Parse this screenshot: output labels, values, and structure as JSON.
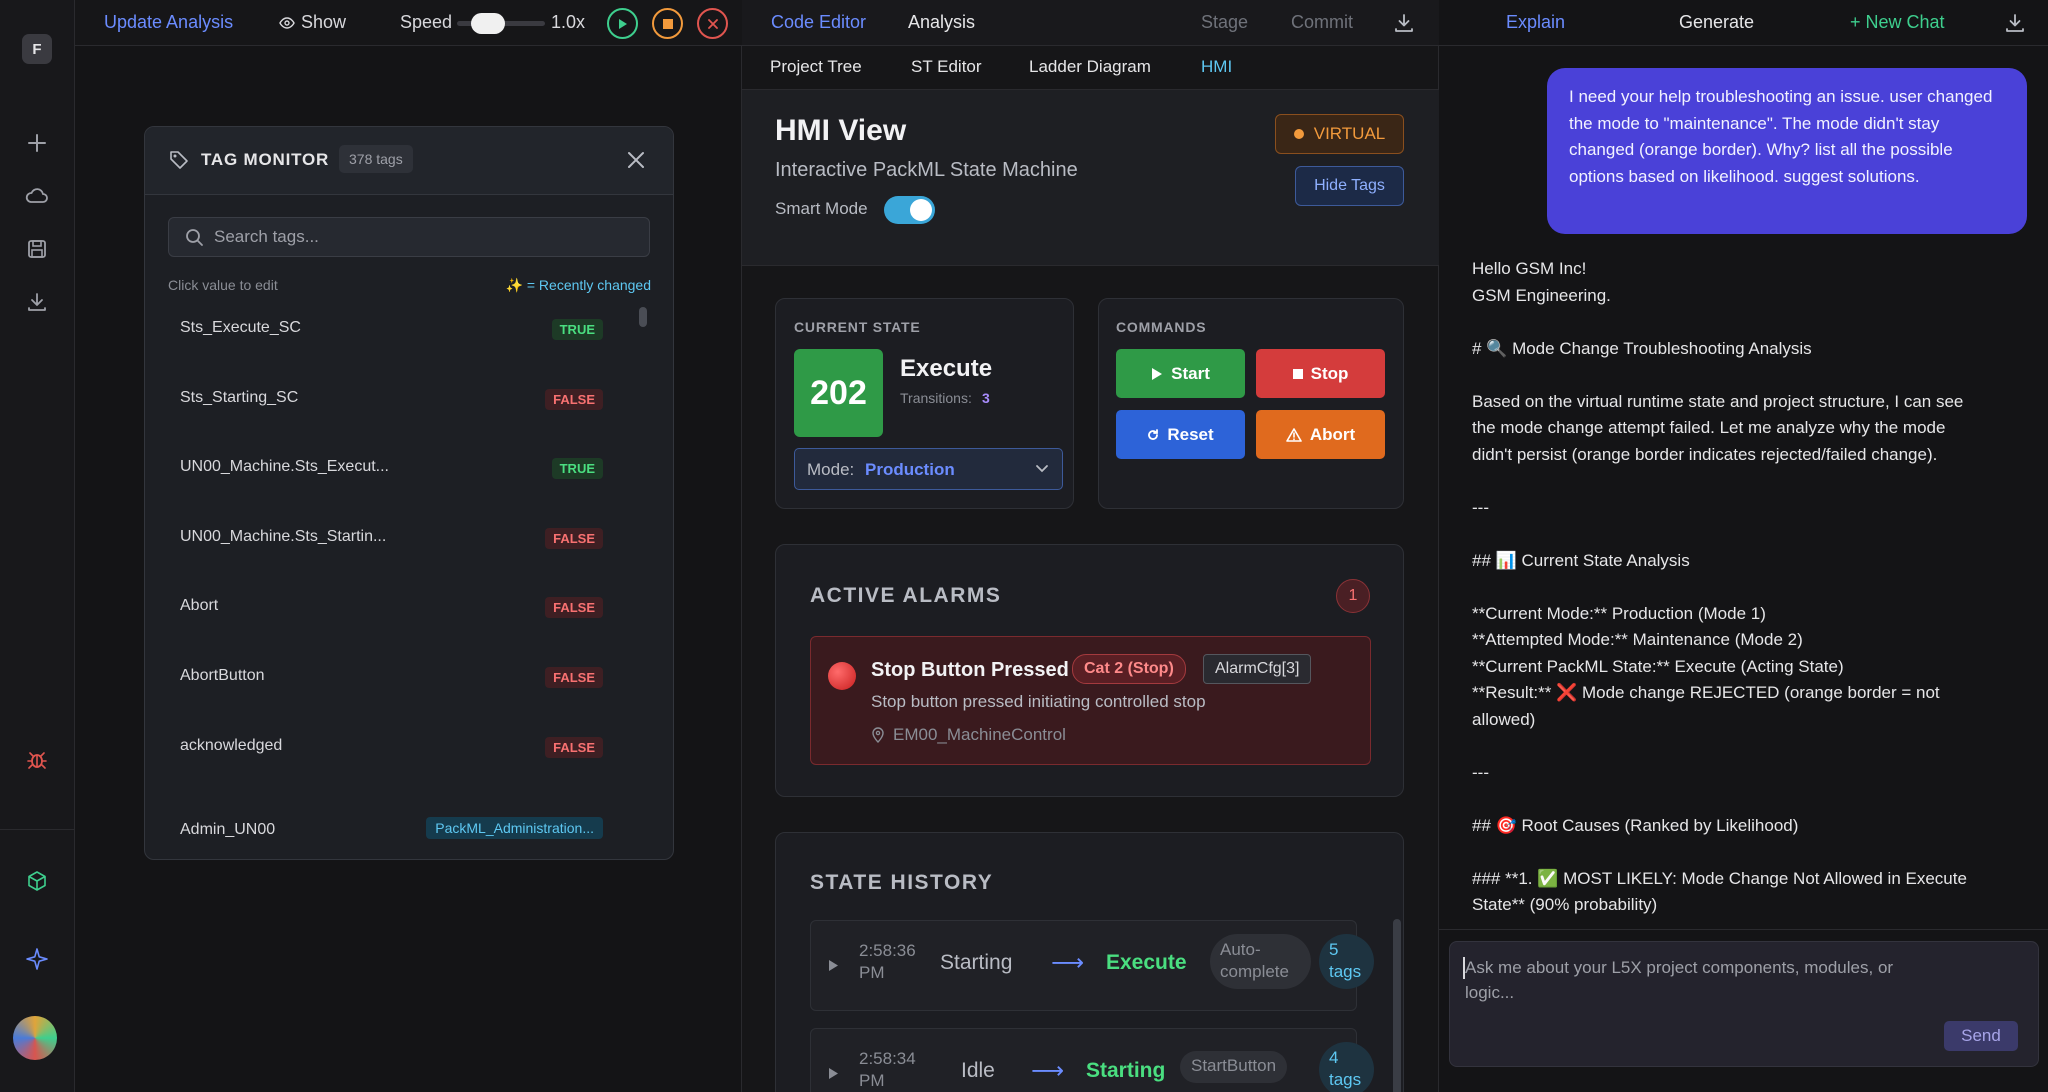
{
  "rail": {
    "logo": "F",
    "icons": [
      "plus-icon",
      "cloud-icon",
      "save-icon",
      "download-icon",
      "bug-icon",
      "cube-icon",
      "sparkle-icon",
      "avatar"
    ]
  },
  "toolbar": {
    "update_analysis": "Update Analysis",
    "show": "Show",
    "speed_label": "Speed",
    "speed_value": "1.0x",
    "speed_fraction": 0.35
  },
  "tag_monitor": {
    "title": "TAG MONITOR",
    "count": "378 tags",
    "search_placeholder": "Search tags...",
    "hint": "Click value to edit",
    "recent_hint": "✨ = Recently changed",
    "rows": [
      {
        "name": "Sts_Execute_SC",
        "value": "TRUE",
        "kind": "true"
      },
      {
        "name": "Sts_Starting_SC",
        "value": "FALSE",
        "kind": "false"
      },
      {
        "name": "UN00_Machine.Sts_Execut...",
        "value": "TRUE",
        "kind": "true"
      },
      {
        "name": "UN00_Machine.Sts_Startin...",
        "value": "FALSE",
        "kind": "false"
      },
      {
        "name": "Abort",
        "value": "FALSE",
        "kind": "false"
      },
      {
        "name": "AbortButton",
        "value": "FALSE",
        "kind": "false"
      },
      {
        "name": "acknowledged",
        "value": "FALSE",
        "kind": "false"
      },
      {
        "name": "Admin_UN00",
        "value": "PackML_Administration...",
        "kind": "type"
      }
    ]
  },
  "middle": {
    "tabs": [
      "Code Editor",
      "Analysis"
    ],
    "stage": "Stage",
    "commit": "Commit",
    "subtabs": [
      "Project Tree",
      "ST Editor",
      "Ladder Diagram",
      "HMI"
    ],
    "hmi_title": "HMI View",
    "hmi_subtitle": "Interactive PackML State Machine",
    "virtual_badge": "VIRTUAL",
    "hide_tags": "Hide Tags",
    "smart_mode": "Smart Mode",
    "current_state": {
      "label": "CURRENT STATE",
      "code": "202",
      "name": "Execute",
      "transitions_label": "Transitions:",
      "transitions": "3",
      "mode_label": "Mode:",
      "mode_value": "Production"
    },
    "commands": {
      "label": "COMMANDS",
      "start": "Start",
      "stop": "Stop",
      "reset": "Reset",
      "abort": "Abort"
    },
    "alarms": {
      "title": "ACTIVE ALARMS",
      "count": "1",
      "alarm_title": "Stop Button Pressed",
      "category": "Cat 2 (Stop)",
      "cfg": "AlarmCfg[3]",
      "description": "Stop button pressed initiating controlled stop",
      "source": "EM00_MachineControl"
    },
    "history": {
      "title": "STATE HISTORY",
      "entries": [
        {
          "time1": "2:58:36",
          "time2": "PM",
          "from": "Starting",
          "to": "Execute",
          "trigger1": "Auto-",
          "trigger2": "complete",
          "tags1": "5",
          "tags2": "tags"
        },
        {
          "time1": "2:58:34",
          "time2": "PM",
          "from": "Idle",
          "to": "Starting",
          "trigger1": "StartButton",
          "trigger2": "",
          "tags1": "4",
          "tags2": "tags"
        }
      ]
    }
  },
  "chat": {
    "tabs": {
      "explain": "Explain",
      "generate": "Generate",
      "new_chat": "+ New Chat"
    },
    "user_message": "I need your help troubleshooting an issue. user changed the mode to \"maintenance\". The mode didn't stay changed (orange border). Why? list all the possible options based on likelihood. suggest solutions.",
    "reply": [
      "Hello GSM Inc!",
      "GSM Engineering.",
      "",
      "# 🔍 Mode Change Troubleshooting Analysis",
      "",
      "Based on the virtual runtime state and project structure, I can see",
      "the mode change attempt failed. Let me analyze why the mode",
      "didn't persist (orange border indicates rejected/failed change).",
      "",
      "---",
      "",
      "## 📊 Current State Analysis",
      "",
      "**Current Mode:** Production (Mode 1)",
      "**Attempted Mode:** Maintenance (Mode 2)",
      "**Current PackML State:** Execute (Acting State)",
      "**Result:** ❌ Mode change REJECTED (orange border = not",
      "allowed)",
      "",
      "---",
      "",
      "## 🎯 Root Causes (Ranked by Likelihood)",
      "",
      "### **1. ✅ MOST LIKELY: Mode Change Not Allowed in Execute",
      "State** (90% probability)"
    ],
    "input_placeholder": "Ask me about your L5X project components, modules, or logic...",
    "send": "Send"
  }
}
